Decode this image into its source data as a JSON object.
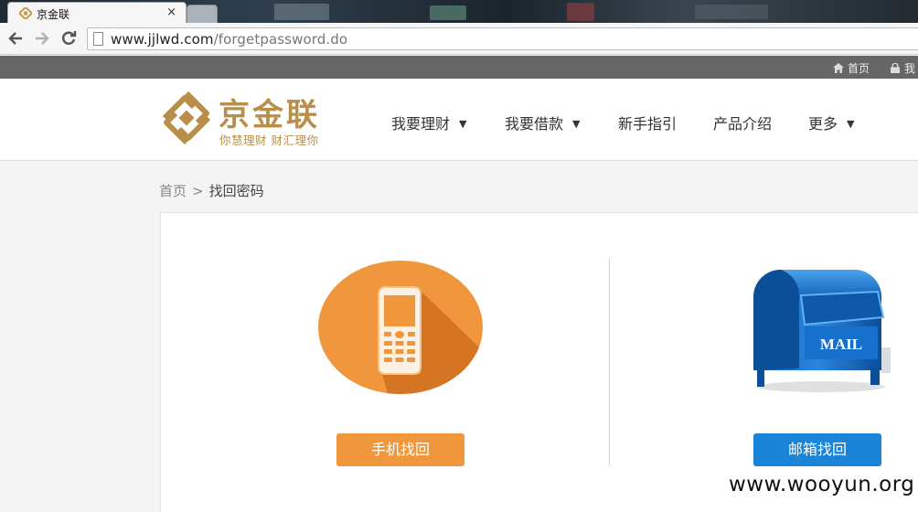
{
  "browser": {
    "tab_title": "京金联",
    "tab_close": "×",
    "url_host": "www.jjlwd.com",
    "url_path": "/forgetpassword.do"
  },
  "topbar": {
    "home": "首页",
    "account": "我"
  },
  "header": {
    "brand": "京金联",
    "slogan": "你慧理财  财汇理你",
    "nav": [
      {
        "label": "我要理财",
        "caret": "▼"
      },
      {
        "label": "我要借款",
        "caret": "▼"
      },
      {
        "label": "新手指引"
      },
      {
        "label": "产品介绍"
      },
      {
        "label": "更多",
        "caret": "▼"
      }
    ]
  },
  "breadcrumb": {
    "home": "首页",
    "sep": ">",
    "current": "找回密码"
  },
  "recovery": {
    "phone_button": "手机找回",
    "mail_button": "邮箱找回",
    "mail_label": "MAIL"
  },
  "watermark": "www.wooyun.org",
  "colors": {
    "brand_gold": "#b88f4a",
    "phone_orange": "#f0963c",
    "mail_blue": "#1b84d6",
    "topbar_gray": "#666666"
  }
}
